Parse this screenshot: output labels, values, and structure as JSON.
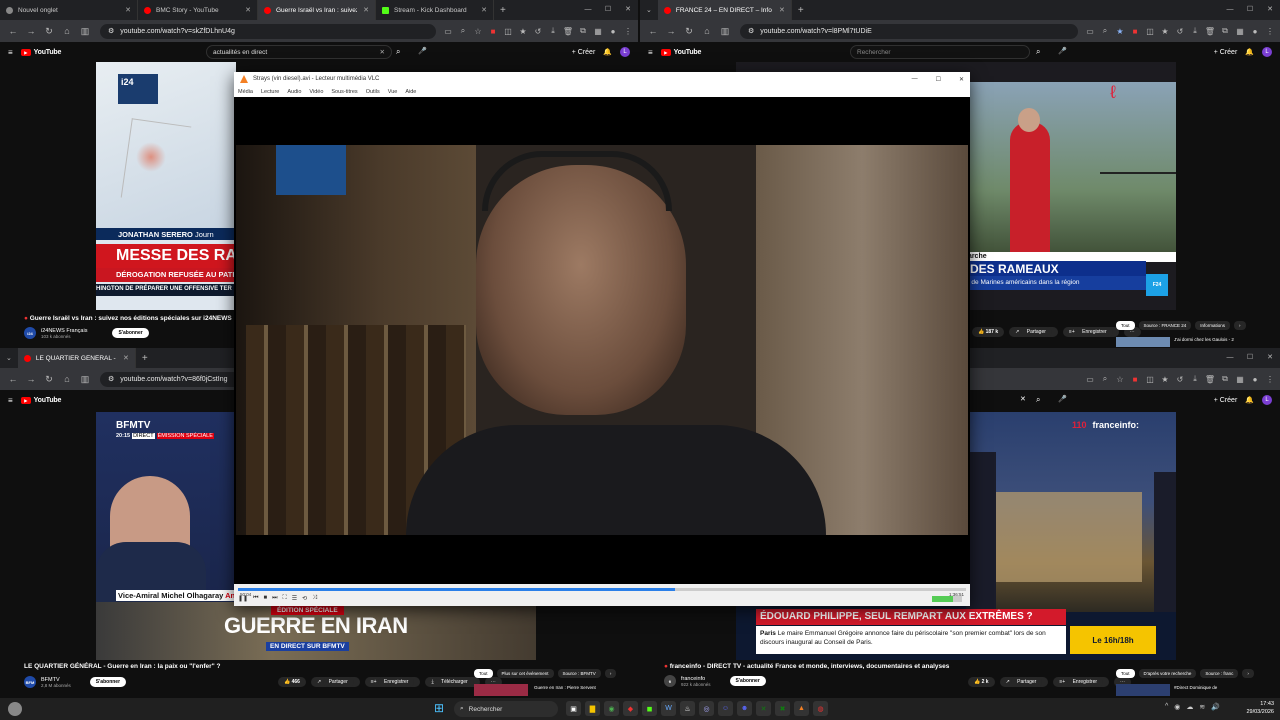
{
  "top_left": {
    "tabs": [
      "Nouvel onglet",
      "BMC Story - YouTube",
      "Guerre Israël vs Iran : suivez",
      "Stream - Kick Dashboard"
    ],
    "url": "youtube.com/watch?v=skZfDLhnU4g",
    "search_query": "actualités en direct",
    "logo": "YouTube",
    "title": "Guerre Israël vs Iran : suivez nos éditions spéciales sur i24NEWS",
    "channel": "i24NEWS Français",
    "subs": "103 k abonnés",
    "subscribe": "S'abonner",
    "overlay_name": "JONATHAN SERERO",
    "overlay_name_suffix": "Journ",
    "headline": "MESSE DES RAMEA",
    "subline": "DÉROGATION REFUSÉE AU PATRI",
    "ticker": "HINGTON DE PRÉPARER UNE OFFENSIVE TER",
    "map_logo": "i24"
  },
  "top_right": {
    "tab": "FRANCE 24 – EN DIRECT – Info",
    "url": "youtube.com/watch?v=l8PMl7tUDiE",
    "search_placeholder": "Rechercher",
    "create": "Créer",
    "banner_small": "iarche",
    "banner_big": "DES RAMEAUX",
    "banner_sub": "e de Marines américains dans la région",
    "likes": "187 k",
    "share": "Partager",
    "save": "Enregistrer",
    "chips": [
      "Tout",
      "Source : FRANCE 24",
      "Informations"
    ],
    "rec": "J'ai dormi chez les Gaulois - 2"
  },
  "bottom_left": {
    "tab": "LE QUARTIER GÉNÉRAL - Guer",
    "url": "youtube.com/watch?v=86f0jCstIng",
    "title": "LE QUARTIER GÉNÉRAL - Guerre en Iran : la paix ou \"l'enfer\" ?",
    "channel": "BFMTV",
    "subs": "2,8 M abonnés",
    "subscribe": "S'abonner",
    "likes": "466",
    "share": "Partager",
    "save": "Enregistrer",
    "download": "Télécharger",
    "chips": [
      "Tout",
      "Plus sur cet événement",
      "Source : BFMTV"
    ],
    "bfm_logo": "BFMTV",
    "bfm_time": "20:15",
    "bfm_direct": "DIRECT",
    "bfm_special": "ÉMISSION SPÉCIALE",
    "guest": "Vice-Amiral Michel Olhagaray",
    "guest_suffix": "An",
    "edition": "ÉDITION SPÉCIALE",
    "war": "GUERRE EN IRAN",
    "live": "EN DIRECT SUR BFMTV",
    "rec": "Guerre en Iran : Pierre Servent"
  },
  "bottom_right": {
    "title": "franceinfo - DIRECT TV - actualité France et monde, interviews, documentaires et analyses",
    "channel": "franceinfo",
    "subs": "922 k abonnés",
    "subscribe": "S'abonner",
    "likes": "2 k",
    "share": "Partager",
    "save": "Enregistrer",
    "chips": [
      "Tout",
      "D'après votre recherche",
      "Source : franc"
    ],
    "ch_number": "110",
    "ch_name": "franceinfo:",
    "headline": "ÉDOUARD PHILIPPE, SEUL REMPART AUX EXTRÊMES ?",
    "city": "Paris",
    "story": "Le maire Emmanuel Grégoire annonce faire du périscolaire \"son premier combat\" lors de son discours inaugural au Conseil de Paris.",
    "slot": "Le 16h/18h",
    "rec": "#Direct Dominique de"
  },
  "vlc": {
    "title": "Strays (vin diesel).avi - Lecteur multimédia VLC",
    "menu": [
      "Média",
      "Lecture",
      "Audio",
      "Vidéo",
      "Sous-titres",
      "Outils",
      "Vue",
      "Aide"
    ],
    "elapsed": "50:04",
    "total": "1:36:51",
    "progress": 0.6
  },
  "taskbar": {
    "search": "Rechercher",
    "time": "17:43",
    "date": "29/03/2026"
  }
}
